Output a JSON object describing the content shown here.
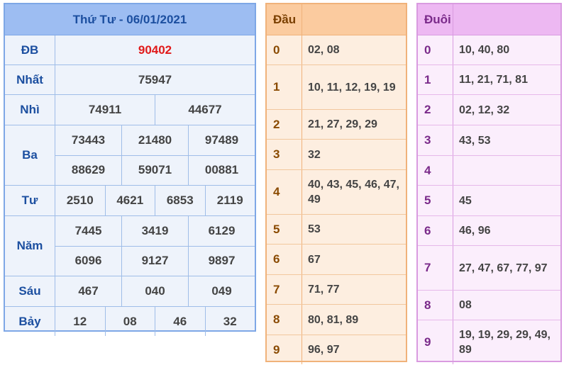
{
  "results": {
    "title": "Thứ Tư - 06/01/2021",
    "prizes": [
      {
        "label": "ĐB",
        "lines": [
          [
            "90402"
          ]
        ]
      },
      {
        "label": "Nhất",
        "lines": [
          [
            "75947"
          ]
        ]
      },
      {
        "label": "Nhì",
        "lines": [
          [
            "74911",
            "44677"
          ]
        ]
      },
      {
        "label": "Ba",
        "lines": [
          [
            "73443",
            "21480",
            "97489"
          ],
          [
            "88629",
            "59071",
            "00881"
          ]
        ]
      },
      {
        "label": "Tư",
        "lines": [
          [
            "2510",
            "4621",
            "6853",
            "2119"
          ]
        ]
      },
      {
        "label": "Năm",
        "lines": [
          [
            "7445",
            "3419",
            "6129"
          ],
          [
            "6096",
            "9127",
            "9897"
          ]
        ]
      },
      {
        "label": "Sáu",
        "lines": [
          [
            "467",
            "040",
            "049"
          ]
        ]
      },
      {
        "label": "Bảy",
        "lines": [
          [
            "12",
            "08",
            "46",
            "32"
          ]
        ]
      }
    ]
  },
  "dau": {
    "header": "Đầu",
    "rows": [
      {
        "k": "0",
        "v": "02, 08"
      },
      {
        "k": "1",
        "v": "10, 11, 12, 19, 19"
      },
      {
        "k": "2",
        "v": "21, 27, 29, 29"
      },
      {
        "k": "3",
        "v": "32"
      },
      {
        "k": "4",
        "v": "40, 43, 45, 46, 47, 49"
      },
      {
        "k": "5",
        "v": "53"
      },
      {
        "k": "6",
        "v": "67"
      },
      {
        "k": "7",
        "v": "71, 77"
      },
      {
        "k": "8",
        "v": "80, 81, 89"
      },
      {
        "k": "9",
        "v": "96, 97"
      }
    ]
  },
  "duoi": {
    "header": "Đuôi",
    "rows": [
      {
        "k": "0",
        "v": "10, 40, 80"
      },
      {
        "k": "1",
        "v": "11, 21, 71, 81"
      },
      {
        "k": "2",
        "v": "02, 12, 32"
      },
      {
        "k": "3",
        "v": "43, 53"
      },
      {
        "k": "4",
        "v": ""
      },
      {
        "k": "5",
        "v": "45"
      },
      {
        "k": "6",
        "v": "46, 96"
      },
      {
        "k": "7",
        "v": "27, 47, 67, 77, 97"
      },
      {
        "k": "8",
        "v": "08"
      },
      {
        "k": "9",
        "v": "19, 19, 29, 29, 49, 89"
      }
    ]
  },
  "colors": {
    "special_prize": "#e01a1a",
    "results_header": "#9dbdf2",
    "dau_header": "#fbcb9f",
    "duoi_header": "#edb8f2"
  }
}
